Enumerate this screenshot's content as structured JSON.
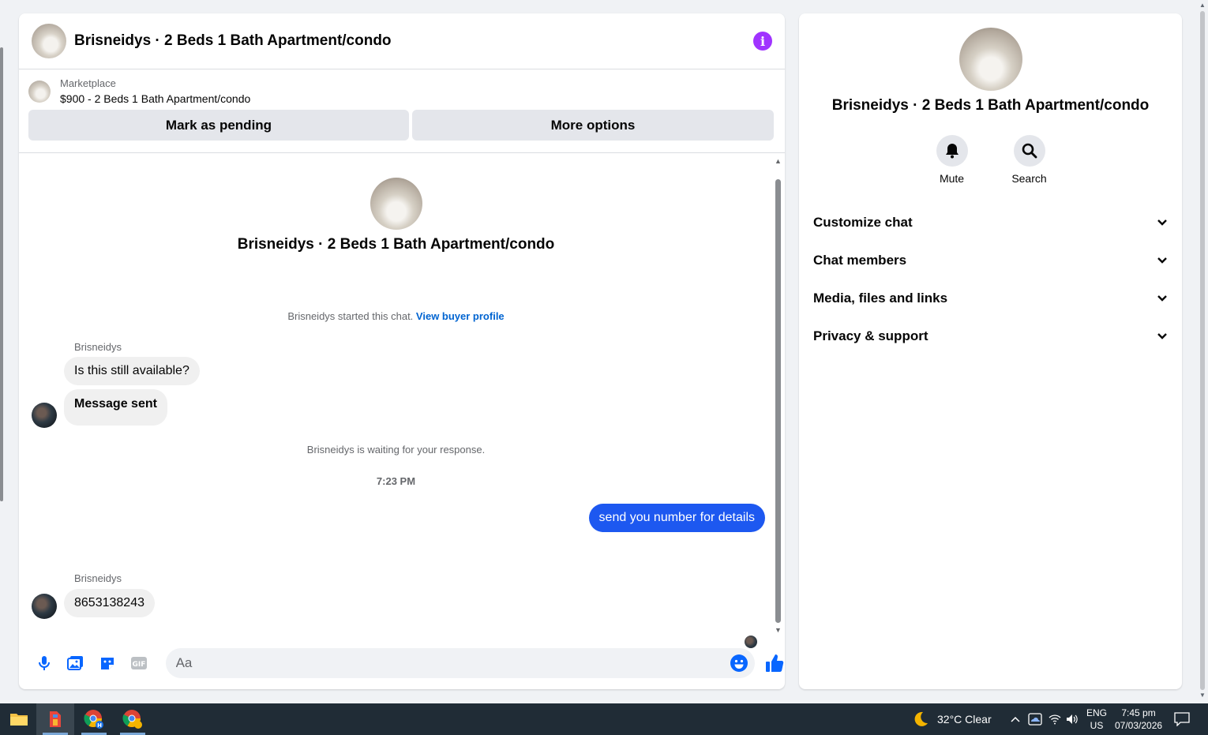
{
  "conversation": {
    "title": "Brisneidys · 2 Beds 1 Bath Apartment/condo",
    "info_icon": "info-icon"
  },
  "listing": {
    "kicker": "Marketplace",
    "price_title": "$900 - 2 Beds 1 Bath Apartment/condo",
    "mark_pending_label": "Mark as pending",
    "more_options_label": "More options"
  },
  "messages": {
    "intro_title": "Brisneidys · 2 Beds 1 Bath Apartment/condo",
    "started_text": "Brisneidys started this chat.",
    "view_buyer_link": "View buyer profile",
    "sender_1": "Brisneidys",
    "msg_1": "Is this still available?",
    "msg_2": "Message sent",
    "waiting_text": "Brisneidys is waiting for your response.",
    "timestamp": "7:23 PM",
    "outgoing_1": "send you number for details",
    "sender_2": "Brisneidys",
    "msg_3": "8653138243"
  },
  "composer": {
    "placeholder": "Aa",
    "tools": [
      "microphone-icon",
      "photo-icon",
      "sticker-icon",
      "gif-icon"
    ],
    "emoji_icon": "emoji-icon",
    "like_icon": "thumbs-up-icon"
  },
  "info_panel": {
    "title": "Brisneidys · 2 Beds 1 Bath Apartment/condo",
    "mute_label": "Mute",
    "search_label": "Search",
    "sections": [
      "Customize chat",
      "Chat members",
      "Media, files and links",
      "Privacy & support"
    ]
  },
  "taskbar": {
    "weather": "32°C  Clear",
    "lang_top": "ENG",
    "lang_bottom": "US",
    "time": "7:45 pm",
    "date": "07/03/2026"
  },
  "colors": {
    "accent_blue": "#1d58f0",
    "info_purple": "#a033ff",
    "link_blue": "#0064d1",
    "taskbar_bg": "#202c36"
  }
}
